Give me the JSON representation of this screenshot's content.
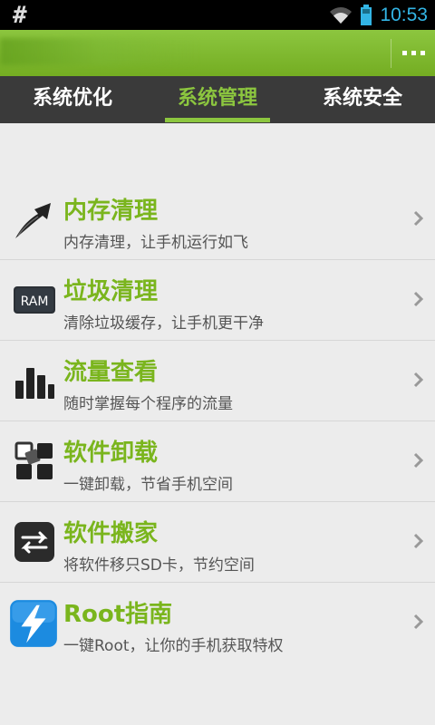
{
  "status_bar": {
    "symbol": "#",
    "time": "10:53"
  },
  "app_bar": {
    "overflow_icon": "overflow-menu-icon"
  },
  "tabs": [
    {
      "label": "系统优化",
      "active": false
    },
    {
      "label": "系统管理",
      "active": true
    },
    {
      "label": "系统安全",
      "active": false
    }
  ],
  "items": [
    {
      "title": "内存清理",
      "subtitle": "内存清理，让手机运行如飞",
      "icon": "arrow-up-icon"
    },
    {
      "title": "垃圾清理",
      "subtitle": "清除垃圾缓存，让手机更干净",
      "icon": "ram-icon",
      "icon_text": "RAM"
    },
    {
      "title": "流量查看",
      "subtitle": "随时掌握每个程序的流量",
      "icon": "bar-chart-icon"
    },
    {
      "title": "软件卸载",
      "subtitle": "一键卸载，节省手机空间",
      "icon": "app-grid-icon"
    },
    {
      "title": "软件搬家",
      "subtitle": "将软件移只SD卡，节约空间",
      "icon": "transfer-icon"
    },
    {
      "title": "Root指南",
      "subtitle": "一键Root，让你的手机获取特权",
      "icon": "lightning-icon"
    }
  ],
  "colors": {
    "accent": "#8cc63f",
    "title_green": "#7ab51d",
    "tab_bg": "#3a3a3a",
    "status_time": "#33b5e5"
  }
}
